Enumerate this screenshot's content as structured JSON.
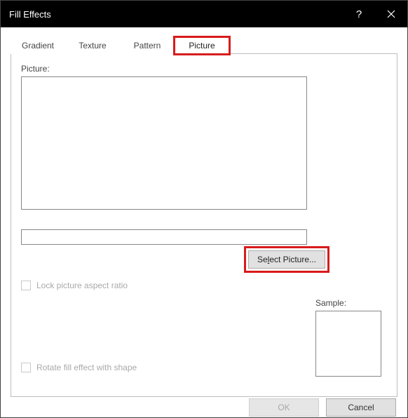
{
  "titlebar": {
    "title": "Fill Effects"
  },
  "tabs": {
    "gradient": "Gradient",
    "texture": "Texture",
    "pattern": "Pattern",
    "picture": "Picture"
  },
  "panel": {
    "picture_label": "Picture:",
    "picture_name_value": "",
    "select_picture_prefix": "Se",
    "select_picture_uchar": "l",
    "select_picture_suffix": "ect Picture...",
    "lock_aspect": "Lock picture aspect ratio",
    "rotate_fill": "Rotate fill effect with shape",
    "sample_label": "Sample:"
  },
  "buttons": {
    "ok": "OK",
    "cancel": "Cancel"
  }
}
